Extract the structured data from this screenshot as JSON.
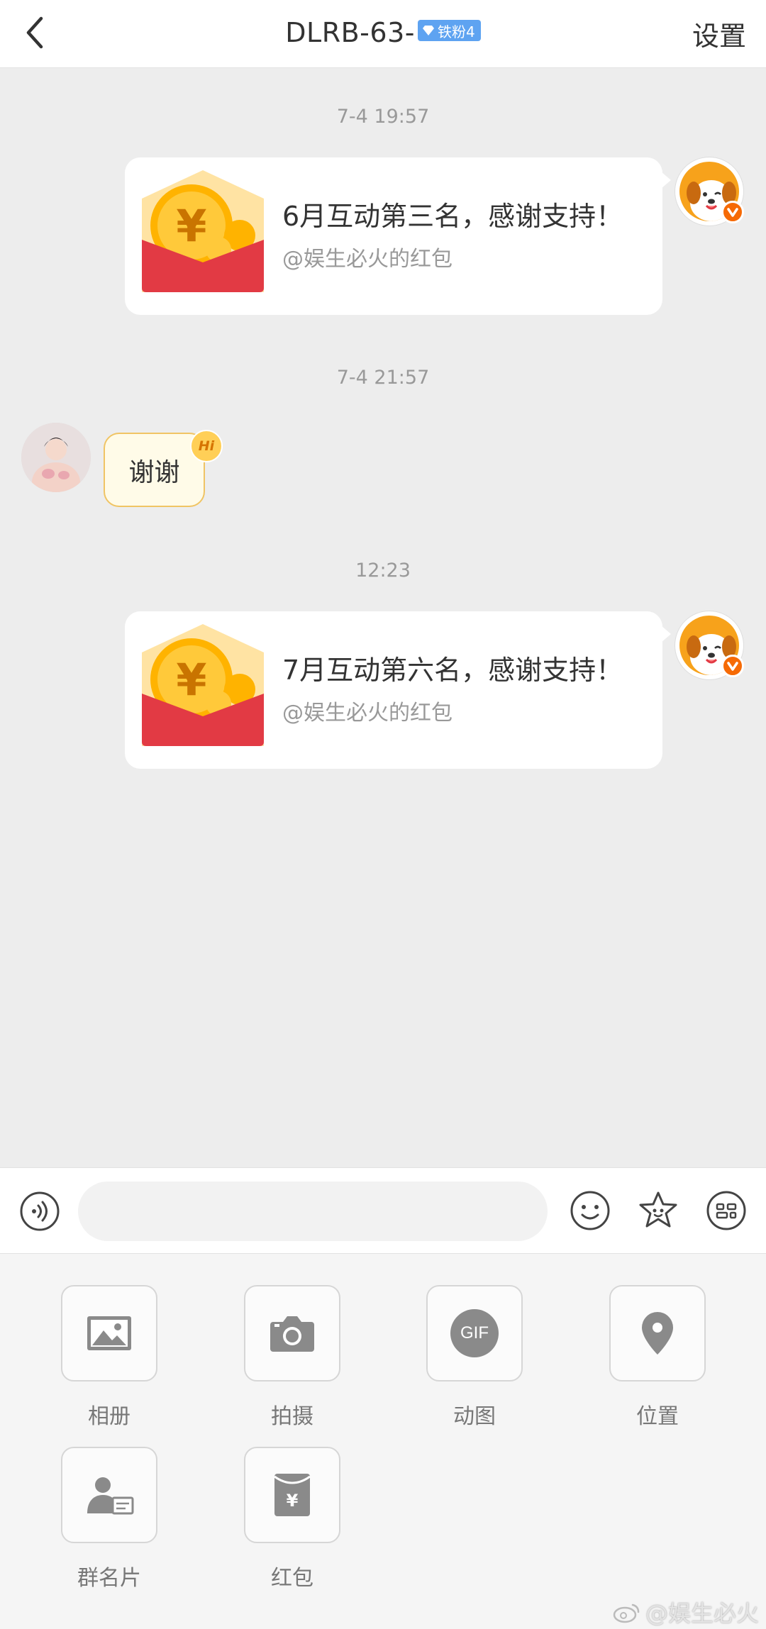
{
  "header": {
    "title": "DLRB-63-",
    "badge_label": "铁粉4",
    "settings_label": "设置"
  },
  "messages": {
    "t1": "7-4 19:57",
    "rp1_title": "6月互动第三名，感谢支持！",
    "rp1_sender": "@娱生必火的红包",
    "t2": "7-4 21:57",
    "reply_text": "谢谢",
    "reply_badge": "Hi",
    "t3": "12:23",
    "rp2_title": "7月互动第六名，感谢支持！",
    "rp2_sender": "@娱生必火的红包"
  },
  "input": {
    "placeholder": ""
  },
  "tools": {
    "album": "相册",
    "camera": "拍摄",
    "gif": "动图",
    "gif_icon_text": "GIF",
    "location": "位置",
    "group_card": "群名片",
    "red_packet": "红包"
  },
  "watermark": "@娱生必火",
  "colors": {
    "chat_bg": "#ededed",
    "red_packet": "#e23a44",
    "coin": "#ffb300",
    "fan_badge": "#5ea3f1",
    "verified": "#f66a05"
  }
}
